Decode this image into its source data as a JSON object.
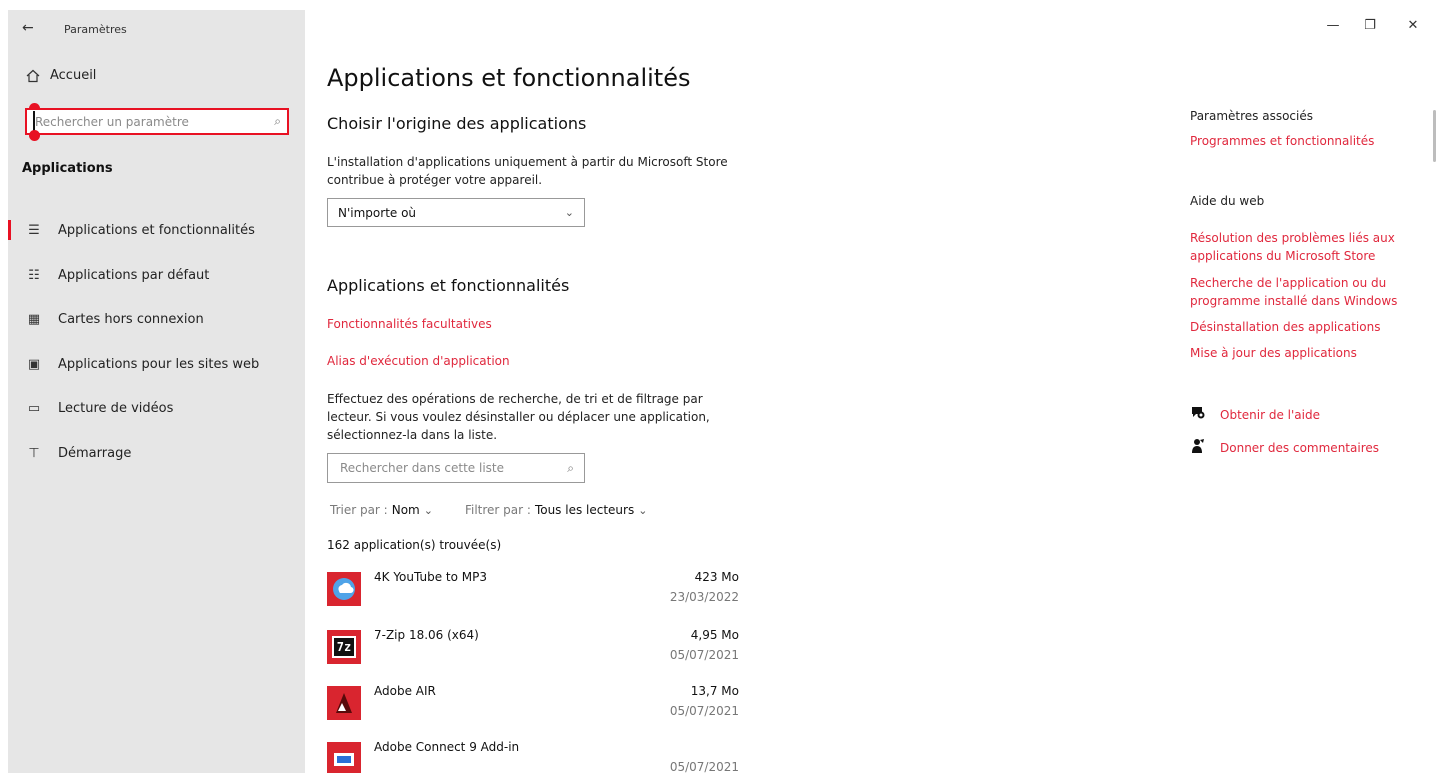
{
  "window": {
    "title": "Paramètres",
    "back_glyph": "←",
    "minimize_glyph": "—",
    "maximize_glyph": "❐",
    "close_glyph": "✕"
  },
  "sidebar": {
    "home_label": "Accueil",
    "home_icon": "home-icon",
    "search_placeholder": "Rechercher un paramètre",
    "section_label": "Applications",
    "items": [
      {
        "label": "Applications et fonctionnalités",
        "icon": "apps-features-icon",
        "glyph": "☰",
        "active": true
      },
      {
        "label": "Applications par défaut",
        "icon": "default-apps-icon",
        "glyph": "☷",
        "active": false
      },
      {
        "label": "Cartes hors connexion",
        "icon": "offline-maps-icon",
        "glyph": "▦",
        "active": false
      },
      {
        "label": "Applications pour les sites web",
        "icon": "apps-websites-icon",
        "glyph": "▣",
        "active": false
      },
      {
        "label": "Lecture de vidéos",
        "icon": "video-playback-icon",
        "glyph": "▭",
        "active": false
      },
      {
        "label": "Démarrage",
        "icon": "startup-icon",
        "glyph": "⊤",
        "active": false
      }
    ]
  },
  "main": {
    "title": "Applications et fonctionnalités",
    "source_heading": "Choisir l'origine des applications",
    "source_description_line1": "L'installation d'applications uniquement à partir du Microsoft Store",
    "source_description_line2": "contribue à protéger votre appareil.",
    "source_dropdown_value": "N'importe où",
    "apps_heading": "Applications et fonctionnalités",
    "link_optional_features": "Fonctionnalités facultatives",
    "link_app_aliases": "Alias d'exécution d'application",
    "search_description_line1": "Effectuez des opérations de recherche, de tri et de filtrage par",
    "search_description_line2": "lecteur. Si vous voulez désinstaller ou déplacer une application,",
    "search_description_line3": "sélectionnez-la dans la liste.",
    "list_search_placeholder": "Rechercher dans cette liste",
    "sort_label": "Trier par :",
    "sort_value": "Nom",
    "filter_label": "Filtrer par :",
    "filter_value": "Tous les lecteurs",
    "count_text": "162 application(s) trouvée(s)",
    "apps": [
      {
        "name": "4K YouTube to MP3",
        "size": "423 Mo",
        "date": "23/03/2022",
        "icon": "youtube-mp3-icon"
      },
      {
        "name": "7-Zip 18.06 (x64)",
        "size": "4,95 Mo",
        "date": "05/07/2021",
        "icon": "7zip-icon",
        "icon_text": "7z"
      },
      {
        "name": "Adobe AIR",
        "size": "13,7 Mo",
        "date": "05/07/2021",
        "icon": "adobe-air-icon"
      },
      {
        "name": "Adobe Connect 9 Add-in",
        "size": "",
        "date": "05/07/2021",
        "icon": "adobe-connect-icon"
      }
    ]
  },
  "right": {
    "related_heading": "Paramètres associés",
    "related_link": "Programmes et fonctionnalités",
    "web_help_heading": "Aide du web",
    "web_links": [
      "Résolution des problèmes liés aux applications du Microsoft Store",
      "Recherche de l'application ou du programme installé dans Windows",
      "Désinstallation des applications",
      "Mise à jour des applications"
    ],
    "get_help": "Obtenir de l'aide",
    "give_feedback": "Donner des commentaires"
  },
  "colors": {
    "accent": "#e0283d",
    "highlight_border": "#e81123",
    "sidebar_bg": "#e6e6e6"
  }
}
